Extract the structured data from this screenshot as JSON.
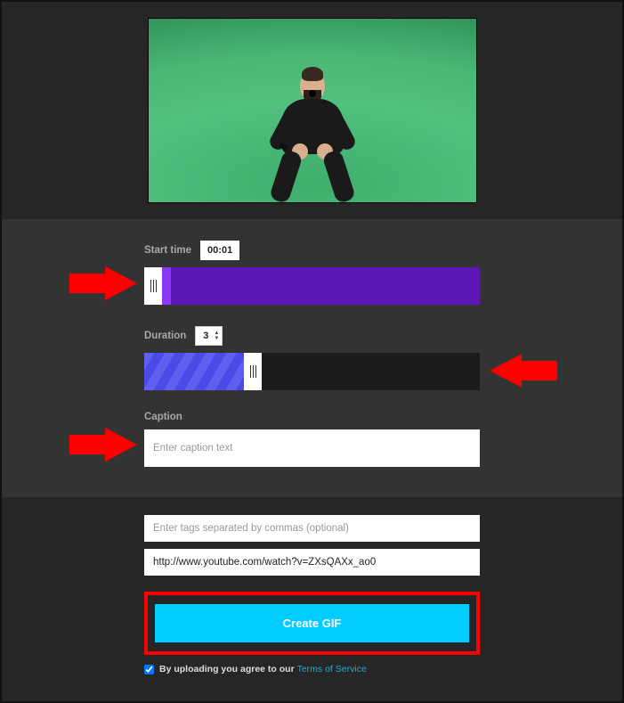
{
  "startTime": {
    "label": "Start time",
    "value": "00:01"
  },
  "duration": {
    "label": "Duration",
    "value": "3"
  },
  "caption": {
    "label": "Caption",
    "placeholder": "Enter caption text"
  },
  "tags": {
    "placeholder": "Enter tags separated by commas (optional)"
  },
  "source": {
    "value": "http://www.youtube.com/watch?v=ZXsQAXx_ao0"
  },
  "createButton": "Create GIF",
  "terms": {
    "prefix": "By uploading you agree to our ",
    "link": "Terms of Service"
  }
}
